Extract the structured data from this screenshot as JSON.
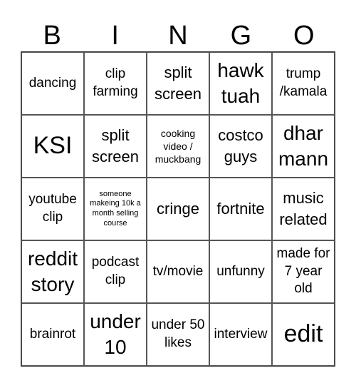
{
  "header": [
    "B",
    "I",
    "N",
    "G",
    "O"
  ],
  "cells": [
    {
      "text": "dancing",
      "size": "md"
    },
    {
      "text": "clip farming",
      "size": "md"
    },
    {
      "text": "split screen",
      "size": "lg"
    },
    {
      "text": "hawk tuah",
      "size": "xl"
    },
    {
      "text": "trump /kamala",
      "size": "md"
    },
    {
      "text": "KSI",
      "size": "xxl"
    },
    {
      "text": "split screen",
      "size": "lg"
    },
    {
      "text": "cooking video / muckbang",
      "size": "sm"
    },
    {
      "text": "costco guys",
      "size": "lg"
    },
    {
      "text": "dhar mann",
      "size": "xl"
    },
    {
      "text": "youtube clip",
      "size": "md"
    },
    {
      "text": "someone makeing 10k a month selling course",
      "size": "xs"
    },
    {
      "text": "cringe",
      "size": "lg"
    },
    {
      "text": "fortnite",
      "size": "lg"
    },
    {
      "text": "music related",
      "size": "lg"
    },
    {
      "text": "reddit story",
      "size": "xl"
    },
    {
      "text": "podcast clip",
      "size": "md"
    },
    {
      "text": "tv/movie",
      "size": "md"
    },
    {
      "text": "unfunny",
      "size": "md"
    },
    {
      "text": "made for 7 year old",
      "size": "md"
    },
    {
      "text": "brainrot",
      "size": "md"
    },
    {
      "text": "under 10",
      "size": "xl"
    },
    {
      "text": "under 50 likes",
      "size": "md"
    },
    {
      "text": "interview",
      "size": "md"
    },
    {
      "text": "edit",
      "size": "xxl"
    }
  ]
}
